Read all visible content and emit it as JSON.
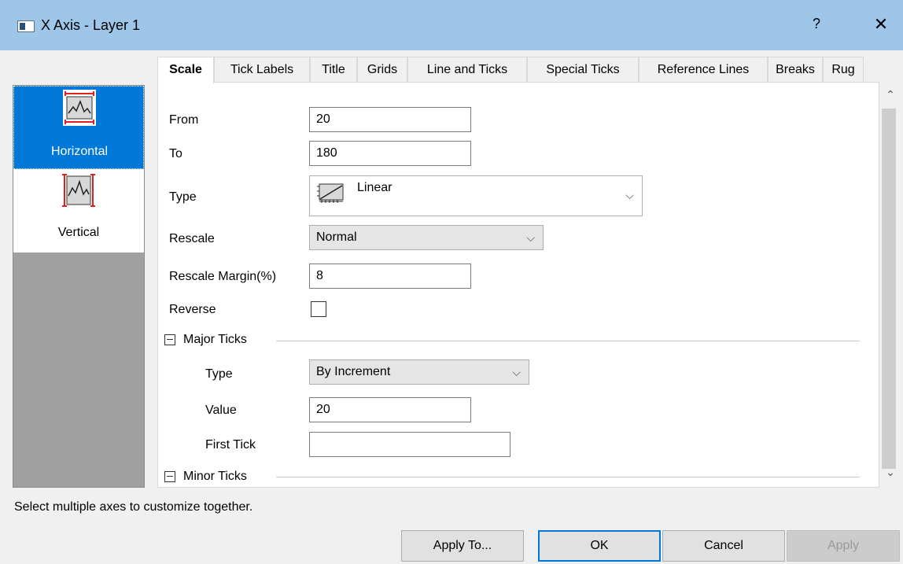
{
  "window": {
    "title": "X Axis - Layer 1",
    "help_label": "?",
    "close_label": "✕",
    "app_icon": "axis-dialog-icon"
  },
  "tabs": [
    {
      "label": "Scale",
      "active": true
    },
    {
      "label": "Tick Labels"
    },
    {
      "label": "Title"
    },
    {
      "label": "Grids"
    },
    {
      "label": "Line and Ticks"
    },
    {
      "label": "Special Ticks"
    },
    {
      "label": "Reference Lines"
    },
    {
      "label": "Breaks"
    },
    {
      "label": "Rug"
    }
  ],
  "axes": [
    {
      "label": "Horizontal",
      "selected": true,
      "icon": "horizontal-axis-icon"
    },
    {
      "label": "Vertical",
      "selected": false,
      "icon": "vertical-axis-icon"
    }
  ],
  "scale": {
    "from_label": "From",
    "from_value": "20",
    "to_label": "To",
    "to_value": "180",
    "type_label": "Type",
    "type_value": "Linear",
    "type_icon": "linear-scale-icon",
    "rescale_label": "Rescale",
    "rescale_value": "Normal",
    "rescale_margin_label": "Rescale Margin(%)",
    "rescale_margin_value": "8",
    "reverse_label": "Reverse",
    "reverse_checked": false
  },
  "major_ticks": {
    "header": "Major Ticks",
    "type_label": "Type",
    "type_value": "By Increment",
    "value_label": "Value",
    "value_value": "20",
    "first_tick_label": "First Tick",
    "first_tick_value": ""
  },
  "minor_ticks": {
    "header": "Minor Ticks"
  },
  "status_text": "Select multiple axes to customize together.",
  "buttons": {
    "apply_to": "Apply To...",
    "ok": "OK",
    "cancel": "Cancel",
    "apply": "Apply"
  },
  "colors": {
    "titlebar": "#9ec6e8",
    "selection": "#0078d7",
    "axis_marker": "#e02020"
  }
}
